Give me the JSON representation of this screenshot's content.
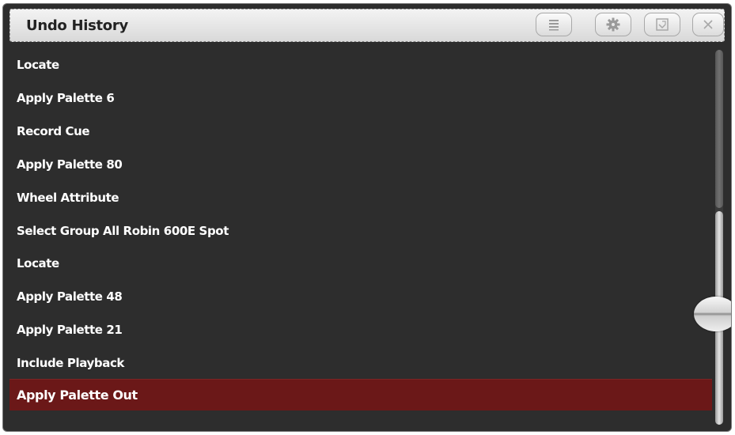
{
  "window": {
    "title": "Undo History"
  },
  "toolbar": {
    "buttons": [
      {
        "name": "menu",
        "icon": "list-menu-icon"
      },
      {
        "name": "settings",
        "icon": "gear-icon"
      },
      {
        "name": "resize",
        "icon": "resize-icon"
      },
      {
        "name": "close",
        "icon": "close-icon"
      }
    ]
  },
  "history": {
    "items": [
      {
        "label": "Locate"
      },
      {
        "label": "Apply Palette  6"
      },
      {
        "label": "Record Cue"
      },
      {
        "label": "Apply Palette  80"
      },
      {
        "label": "Wheel Attribute"
      },
      {
        "label": "Select Group All Robin 600E Spot"
      },
      {
        "label": "Locate"
      },
      {
        "label": "Apply Palette  48"
      },
      {
        "label": "Apply Palette  21"
      },
      {
        "label": "Include Playback"
      },
      {
        "label": "Apply Palette Out",
        "selected": true
      }
    ]
  },
  "colors": {
    "background": "#2d2d2d",
    "selected_row": "#6b1818",
    "text": "#ffffff",
    "titlebar": "#e6e6e6"
  }
}
